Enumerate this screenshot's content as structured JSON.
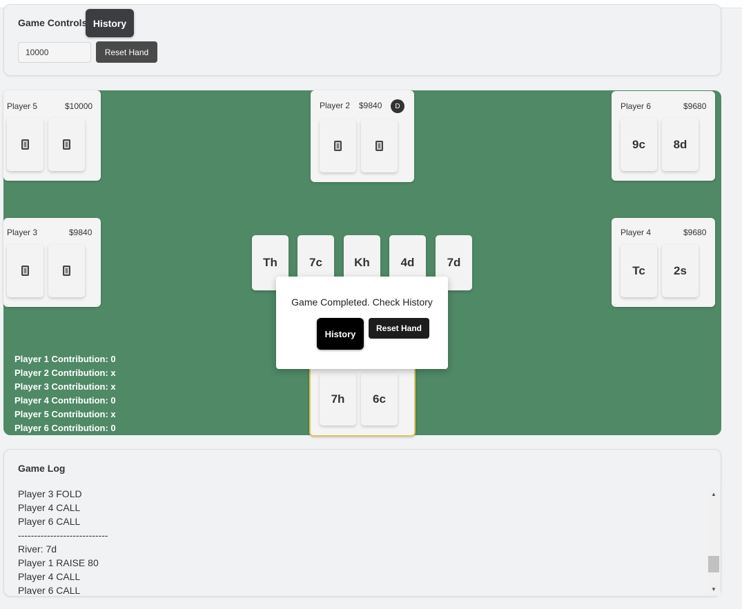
{
  "controls": {
    "title": "Game Controls",
    "history_label": "History",
    "stack_value": "10000",
    "reset_label": "Reset Hand"
  },
  "players": {
    "p5": {
      "name": "Player 5",
      "stack": "$10000"
    },
    "p2": {
      "name": "Player 2",
      "stack": "$9840",
      "dealer": "D"
    },
    "p6": {
      "name": "Player 6",
      "stack": "$9680",
      "cards": [
        "9c",
        "8d"
      ]
    },
    "p3": {
      "name": "Player 3",
      "stack": "$9840"
    },
    "p4": {
      "name": "Player 4",
      "stack": "$9680",
      "cards": [
        "Tc",
        "2s"
      ]
    },
    "p1": {
      "cards": [
        "7h",
        "6c"
      ]
    }
  },
  "board": [
    "Th",
    "7c",
    "Kh",
    "4d",
    "7d"
  ],
  "contributions": [
    "Player 1 Contribution: 0",
    "Player 2 Contribution: x",
    "Player 3 Contribution: x",
    "Player 4 Contribution: 0",
    "Player 5 Contribution: x",
    "Player 6 Contribution: 0"
  ],
  "modal": {
    "message": "Game Completed. Check History",
    "history_label": "History",
    "reset_label": "Reset Hand"
  },
  "log": {
    "title": "Game Log",
    "lines": [
      "Player 3 FOLD",
      "Player 4 CALL",
      "Player 6 CALL",
      "----------------------------",
      "River: 7d",
      "Player 1 RAISE 80",
      "Player 4 CALL",
      "Player 6 CALL"
    ]
  },
  "colors": {
    "table_felt": "#4f8966",
    "active_seat_border": "#e2c35a",
    "dark_button": "#3b3d40"
  }
}
